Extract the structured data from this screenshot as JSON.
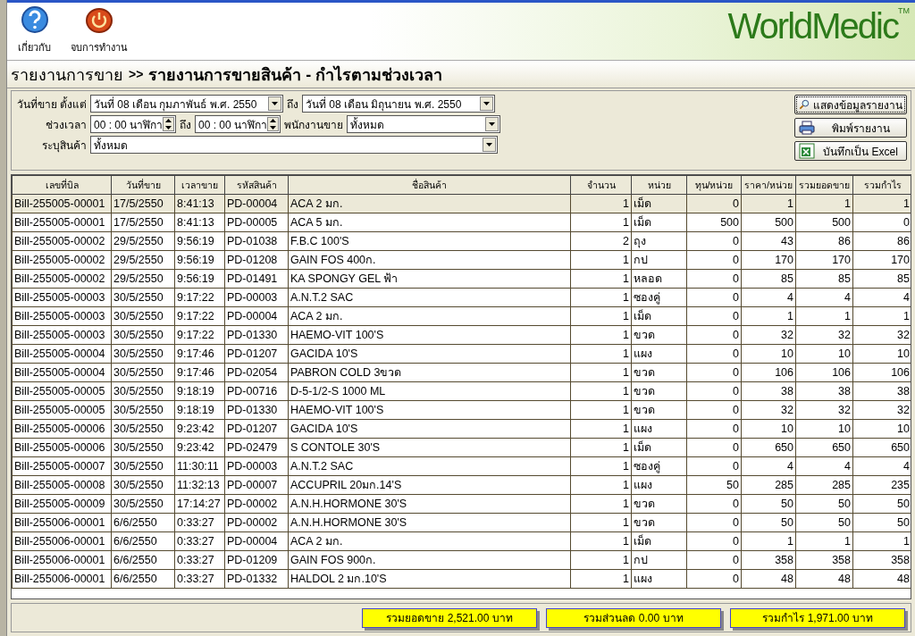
{
  "toolbar": [
    {
      "kind": "help",
      "label": "เกี่ยวกับ"
    },
    {
      "kind": "exit",
      "label": "จบการทำงาน"
    }
  ],
  "logo": {
    "text": "WorldMedic",
    "mark": "TM"
  },
  "page_title": {
    "section": "รายงานการขาย",
    "separator": ">>",
    "title": "รายงานการขายสินค้า - กำไรตามช่วงเวลา"
  },
  "filters": {
    "date_label": "วันที่ขาย  ตั้งแต่",
    "date_from": "วันที่ 08 เดือน กุมภาพันธ์  พ.ศ.  2550",
    "to_label": "ถึง",
    "date_to": "วันที่ 08 เดือน  มิถุนายน   พ.ศ.  2550",
    "time_label": "ช่วงเวลา",
    "time_from": "00 : 00 นาฬิกา",
    "time_to_label": "ถึง",
    "time_to": "00 : 00 นาฬิกา",
    "staff_label": "พนักงานขาย",
    "staff": "ทั้งหมด",
    "product_label": "ระบุสินค้า",
    "product": "ทั้งหมด"
  },
  "actions": [
    {
      "kind": "search",
      "label": "แสดงข้อมูลรายงาน"
    },
    {
      "kind": "print",
      "label": "พิมพ์รายงาน"
    },
    {
      "kind": "excel",
      "label": "บันทึกเป็น Excel"
    }
  ],
  "table": {
    "columns": [
      "เลขที่บิล",
      "วันที่ขาย",
      "เวลาขาย",
      "รหัสสินค้า",
      "ชื่อสินค้า",
      "จำนวน",
      "หน่วย",
      "ทุน/หน่วย",
      "ราคา/หน่วย",
      "รวมยอดขาย",
      "รวมกำไร"
    ],
    "rows": [
      {
        "selected": true,
        "cells": [
          "Bill-255005-00001",
          "17/5/2550",
          "8:41:13",
          "PD-00004",
          "ACA 2 มก.",
          "1",
          "เม็ด",
          "0",
          "1",
          "1",
          "1"
        ]
      },
      {
        "selected": false,
        "cells": [
          "Bill-255005-00001",
          "17/5/2550",
          "8:41:13",
          "PD-00005",
          "ACA 5 มก.",
          "1",
          "เม็ด",
          "500",
          "500",
          "500",
          "0"
        ]
      },
      {
        "selected": false,
        "cells": [
          "Bill-255005-00002",
          "29/5/2550",
          "9:56:19",
          "PD-01038",
          "F.B.C 100'S",
          "2",
          "ถุง",
          "0",
          "43",
          "86",
          "86"
        ]
      },
      {
        "selected": false,
        "cells": [
          "Bill-255005-00002",
          "29/5/2550",
          "9:56:19",
          "PD-01208",
          "GAIN FOS 400ก.",
          "1",
          "กป",
          "0",
          "170",
          "170",
          "170"
        ]
      },
      {
        "selected": false,
        "cells": [
          "Bill-255005-00002",
          "29/5/2550",
          "9:56:19",
          "PD-01491",
          "KA SPONGY GEL ฟ้า",
          "1",
          "หลอด",
          "0",
          "85",
          "85",
          "85"
        ]
      },
      {
        "selected": false,
        "cells": [
          "Bill-255005-00003",
          "30/5/2550",
          "9:17:22",
          "PD-00003",
          "A.N.T.2 SAC",
          "1",
          "ซองคู่",
          "0",
          "4",
          "4",
          "4"
        ]
      },
      {
        "selected": false,
        "cells": [
          "Bill-255005-00003",
          "30/5/2550",
          "9:17:22",
          "PD-00004",
          "ACA 2 มก.",
          "1",
          "เม็ด",
          "0",
          "1",
          "1",
          "1"
        ]
      },
      {
        "selected": false,
        "cells": [
          "Bill-255005-00003",
          "30/5/2550",
          "9:17:22",
          "PD-01330",
          "HAEMO-VIT 100'S",
          "1",
          "ขวด",
          "0",
          "32",
          "32",
          "32"
        ]
      },
      {
        "selected": false,
        "cells": [
          "Bill-255005-00004",
          "30/5/2550",
          "9:17:46",
          "PD-01207",
          "GACIDA 10'S",
          "1",
          "แผง",
          "0",
          "10",
          "10",
          "10"
        ]
      },
      {
        "selected": false,
        "cells": [
          "Bill-255005-00004",
          "30/5/2550",
          "9:17:46",
          "PD-02054",
          "PABRON COLD 3ขวด",
          "1",
          "ขวด",
          "0",
          "106",
          "106",
          "106"
        ]
      },
      {
        "selected": false,
        "cells": [
          "Bill-255005-00005",
          "30/5/2550",
          "9:18:19",
          "PD-00716",
          "D-5-1/2-S 1000 ML",
          "1",
          "ขวด",
          "0",
          "38",
          "38",
          "38"
        ]
      },
      {
        "selected": false,
        "cells": [
          "Bill-255005-00005",
          "30/5/2550",
          "9:18:19",
          "PD-01330",
          "HAEMO-VIT 100'S",
          "1",
          "ขวด",
          "0",
          "32",
          "32",
          "32"
        ]
      },
      {
        "selected": false,
        "cells": [
          "Bill-255005-00006",
          "30/5/2550",
          "9:23:42",
          "PD-01207",
          "GACIDA 10'S",
          "1",
          "แผง",
          "0",
          "10",
          "10",
          "10"
        ]
      },
      {
        "selected": false,
        "cells": [
          "Bill-255005-00006",
          "30/5/2550",
          "9:23:42",
          "PD-02479",
          "S CONTOLE 30'S",
          "1",
          "เม็ด",
          "0",
          "650",
          "650",
          "650"
        ]
      },
      {
        "selected": false,
        "cells": [
          "Bill-255005-00007",
          "30/5/2550",
          "11:30:11",
          "PD-00003",
          "A.N.T.2 SAC",
          "1",
          "ซองคู่",
          "0",
          "4",
          "4",
          "4"
        ]
      },
      {
        "selected": false,
        "cells": [
          "Bill-255005-00008",
          "30/5/2550",
          "11:32:13",
          "PD-00007",
          "ACCUPRIL 20มก.14'S",
          "1",
          "แผง",
          "50",
          "285",
          "285",
          "235"
        ]
      },
      {
        "selected": false,
        "cells": [
          "Bill-255005-00009",
          "30/5/2550",
          "17:14:27",
          "PD-00002",
          "A.N.H.HORMONE 30'S",
          "1",
          "ขวด",
          "0",
          "50",
          "50",
          "50"
        ]
      },
      {
        "selected": false,
        "cells": [
          "Bill-255006-00001",
          "6/6/2550",
          "0:33:27",
          "PD-00002",
          "A.N.H.HORMONE 30'S",
          "1",
          "ขวด",
          "0",
          "50",
          "50",
          "50"
        ]
      },
      {
        "selected": false,
        "cells": [
          "Bill-255006-00001",
          "6/6/2550",
          "0:33:27",
          "PD-00004",
          "ACA 2 มก.",
          "1",
          "เม็ด",
          "0",
          "1",
          "1",
          "1"
        ]
      },
      {
        "selected": false,
        "cells": [
          "Bill-255006-00001",
          "6/6/2550",
          "0:33:27",
          "PD-01209",
          "GAIN FOS 900ก.",
          "1",
          "กป",
          "0",
          "358",
          "358",
          "358"
        ]
      },
      {
        "selected": false,
        "cells": [
          "Bill-255006-00001",
          "6/6/2550",
          "0:33:27",
          "PD-01332",
          "HALDOL 2 มก.10'S",
          "1",
          "แผง",
          "0",
          "48",
          "48",
          "48"
        ]
      }
    ]
  },
  "totals": [
    "รวมยอดขาย 2,521.00 บาท",
    "รวมส่วนลด 0.00 บาท",
    "รวมกำไร 1,971.00 บาท"
  ]
}
